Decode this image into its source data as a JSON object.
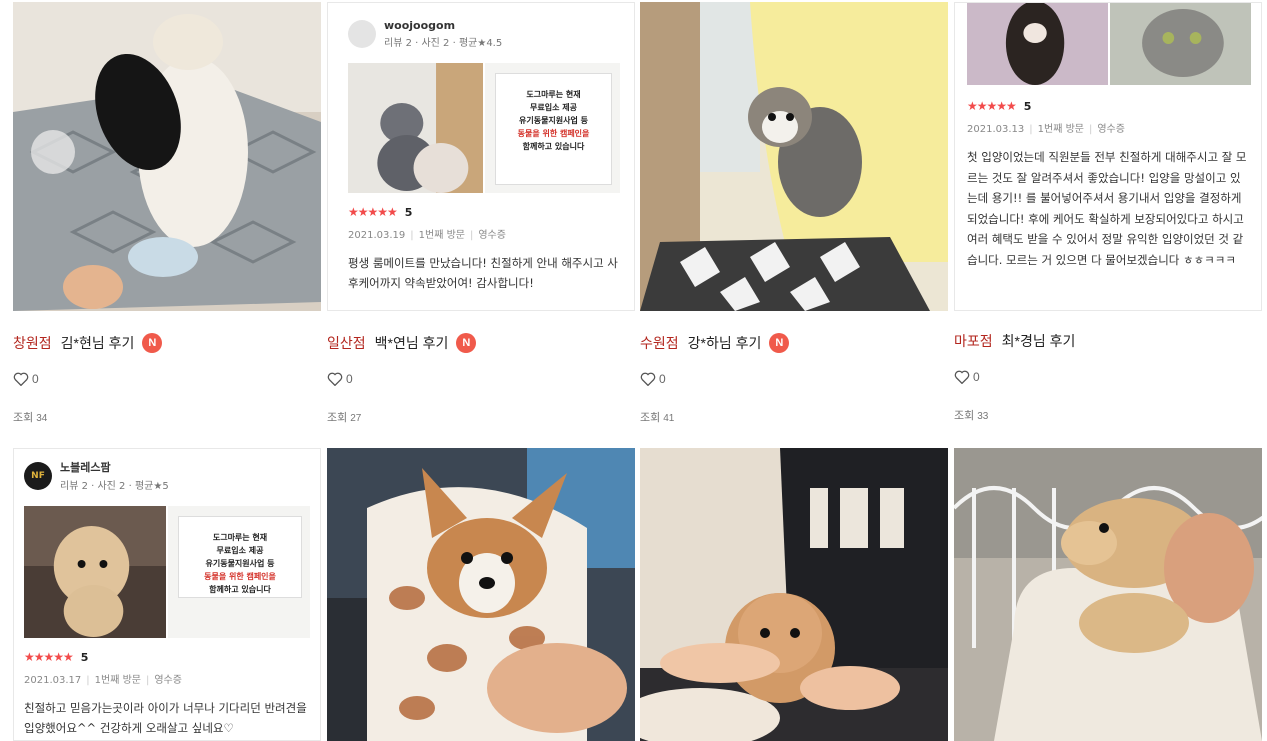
{
  "cards": [
    {
      "branch": "창원점",
      "author": "김*현님 후기",
      "badge": "N",
      "likes": "0",
      "views_label": "조회",
      "views": "34",
      "image": "puppy-white-and-black-on-bed"
    },
    {
      "branch": "일산점",
      "author": "백*연님 후기",
      "badge": "N",
      "likes": "0",
      "views_label": "조회",
      "views": "27",
      "review": {
        "user": "woojoogom",
        "stats": "리뷰 2 · 사진 2 · 평균★4.5",
        "stars": "★★★★★",
        "score": "5",
        "date": "2021.03.19",
        "visit": "1번째 방문",
        "receipt": "영수증",
        "text": "평생 룸메이트를 만났습니다! 친절하게 안내 해주시고 사후케어까지 약속받았어여! 감사합니다!",
        "notice": [
          "도그마루는 현재",
          "무료입소 제공",
          "유기동물지원사업 등",
          "동물을 위한 캠페인을",
          "함께하고 있습니다"
        ]
      }
    },
    {
      "branch": "수원점",
      "author": "강*하님 후기",
      "badge": "N",
      "likes": "0",
      "views_label": "조회",
      "views": "41",
      "image": "kitten-on-yellow-blanket"
    },
    {
      "branch": "마포점",
      "author": "최*경님 후기",
      "badge": "",
      "likes": "0",
      "views_label": "조회",
      "views": "33",
      "review": {
        "stars": "★★★★★",
        "score": "5",
        "date": "2021.03.13",
        "visit": "1번째 방문",
        "receipt": "영수증",
        "text": "첫 입양이었는데 직원분들 전부 친절하게 대해주시고 잘 모르는 것도 잘 알려주셔서 좋았습니다! 입양을 망설이고 있는데 용기!! 를 불어넣어주셔서 용기내서 입양을 결정하게 되었습니다! 후에 케어도 확실하게 보장되어있다고 하시고 여러 혜택도 받을 수 있어서 정말 유익한 입양이었던 것 같습니다. 모르는 거 있으면 다 물어보겠습니다 ㅎㅎㅋㅋㅋ"
      }
    },
    {
      "review": {
        "user": "노블레스팜",
        "stats": "리뷰 2 · 사진 2 · 평균★5",
        "avatar_text": "NF",
        "stars": "★★★★★",
        "score": "5",
        "date": "2021.03.17",
        "visit": "1번째 방문",
        "receipt": "영수증",
        "text": "친절하고 믿음가는곳이라 아이가 너무나 기다리던 반려견을 입양했어요^^ 건강하게 오래살고 싶네요♡",
        "notice": [
          "도그마루는 현재",
          "무료입소 제공",
          "유기동물지원사업 등",
          "동물을 위한 캠페인을",
          "함께하고 있습니다"
        ]
      }
    },
    {
      "image": "corgi-puppy-in-blanket"
    },
    {
      "image": "poodle-puppy-in-hands"
    },
    {
      "image": "golden-retriever-puppy-held"
    }
  ],
  "colors": {
    "branch": "#b3261e",
    "badge": "#f05a4b",
    "stars": "#f24b4b"
  }
}
